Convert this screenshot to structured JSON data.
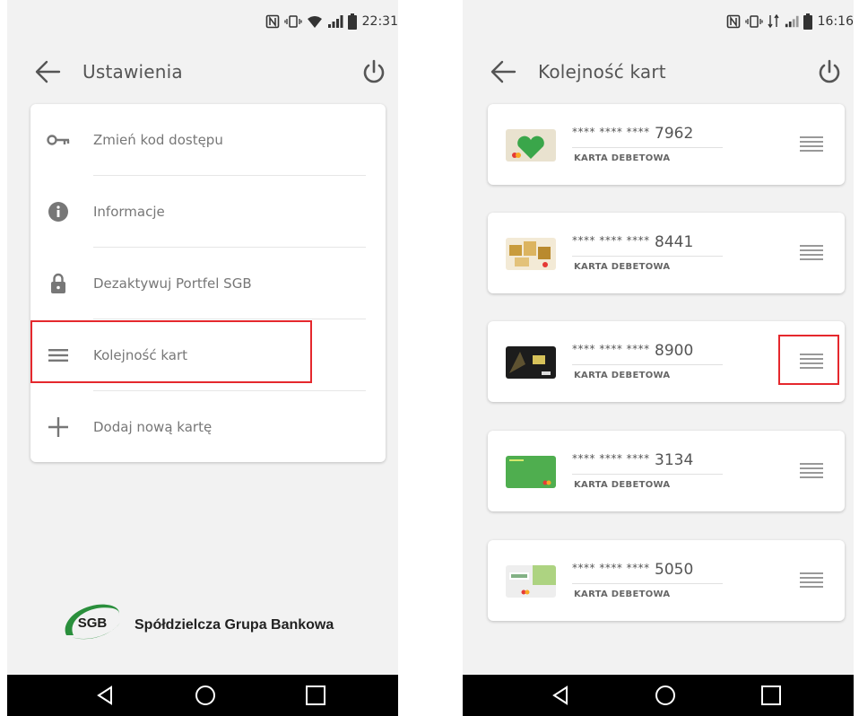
{
  "left_screen": {
    "status_bar": {
      "time": "22:31"
    },
    "header": {
      "title": "Ustawienia"
    },
    "menu": [
      {
        "label": "Zmień kod dostępu",
        "icon": "key-icon"
      },
      {
        "label": "Informacje",
        "icon": "info-icon"
      },
      {
        "label": "Dezaktywuj Portfel SGB",
        "icon": "lock-icon"
      },
      {
        "label": "Kolejność kart",
        "icon": "reorder-icon",
        "highlighted": true
      },
      {
        "label": "Dodaj nową kartę",
        "icon": "plus-icon"
      }
    ],
    "footer": {
      "logo_text": "SGB",
      "bank_name": "Spółdzielcza Grupa Bankowa"
    }
  },
  "right_screen": {
    "status_bar": {
      "time": "16:16"
    },
    "header": {
      "title": "Kolejność kart"
    },
    "cards": [
      {
        "mask": "**** **** ****",
        "last4": "7962",
        "type": "KARTA DEBETOWA"
      },
      {
        "mask": "**** **** ****",
        "last4": "8441",
        "type": "KARTA DEBETOWA"
      },
      {
        "mask": "**** **** ****",
        "last4": "8900",
        "type": "KARTA DEBETOWA",
        "handle_highlighted": true
      },
      {
        "mask": "**** **** ****",
        "last4": "3134",
        "type": "KARTA DEBETOWA"
      },
      {
        "mask": "**** **** ****",
        "last4": "5050",
        "type": "KARTA DEBETOWA"
      }
    ]
  },
  "colors": {
    "highlight": "#e5282d",
    "background": "#f2f2f2",
    "text": "#777777",
    "sgb_green": "#2a8f3c"
  }
}
